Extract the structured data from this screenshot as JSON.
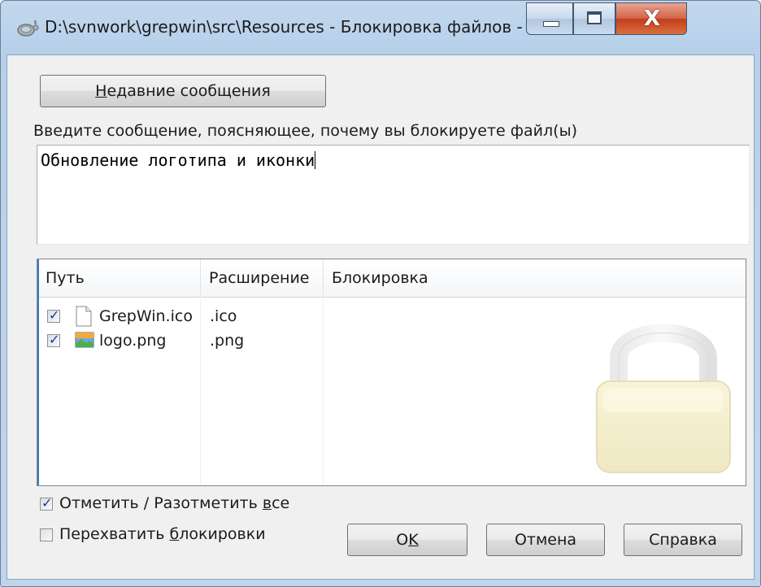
{
  "window": {
    "title": "D:\\svnwork\\grepwin\\src\\Resources - Блокировка файлов - ...",
    "close_glyph": "X",
    "app_icon": "tortoise-icon"
  },
  "buttons": {
    "recent_messages": {
      "pre": "",
      "accel": "Н",
      "post": "едавние сообщения"
    },
    "ok": {
      "pre": "О",
      "accel": "K",
      "post": ""
    },
    "cancel": "Отмена",
    "help": "Справка"
  },
  "message": {
    "prompt": {
      "pre": "Введите сообщение, поясняющее, почему вы блокируете файл(ы)"
    },
    "value": "Обновление логотипа и иконки"
  },
  "file_list": {
    "columns": [
      "Путь",
      "Расширение",
      "Блокировка"
    ],
    "rows": [
      {
        "checked": true,
        "icon": "blank-file-icon",
        "path": "GrepWin.ico",
        "extension": ".ico",
        "lock": ""
      },
      {
        "checked": true,
        "icon": "image-file-icon",
        "path": "logo.png",
        "extension": ".png",
        "lock": ""
      }
    ],
    "watermark_icon": "padlock-icon"
  },
  "options": {
    "toggle_all": {
      "checked": true,
      "pre": "Отметить / Разотметить ",
      "accel": "в",
      "post": "се"
    },
    "steal_locks": {
      "checked": false,
      "pre": "Перехватить ",
      "accel": "б",
      "post": "локировки"
    }
  },
  "colors": {
    "titlebar": "#bfd5ec",
    "close_button": "#c8472b",
    "dialog_bg": "#f0f0f0",
    "check_mark": "#1c3b8f"
  }
}
